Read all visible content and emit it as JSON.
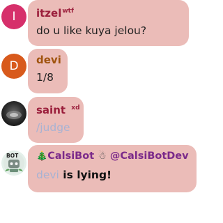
{
  "messages": [
    {
      "avatar_initial": "I",
      "avatar_color": "#d6306b",
      "name": "itzel",
      "name_color": "#9b1f3c",
      "tag": "wtf",
      "text": "do u like kuya jelou?"
    },
    {
      "avatar_initial": "D",
      "avatar_color": "#d85a1c",
      "name": "devi",
      "name_color": "#a0540f",
      "text": "1/8"
    },
    {
      "avatar_icon": "dark-photo-avatar",
      "name": "saint",
      "name_color": "#9b1f3c",
      "tag": "xd",
      "text": "/judge"
    },
    {
      "avatar_icon": "bot-robot-avatar",
      "avatar_badge": "BOT",
      "name_prefix_emoji": "🎄",
      "name": "CalsiBot",
      "name_color": "#7b2a8a",
      "name_suffix_emoji": "☃",
      "mention": "@CalsiBotDev",
      "mention_color": "#7b2a8a",
      "text_mention": "devi",
      "text_rest": " is lying!"
    }
  ]
}
